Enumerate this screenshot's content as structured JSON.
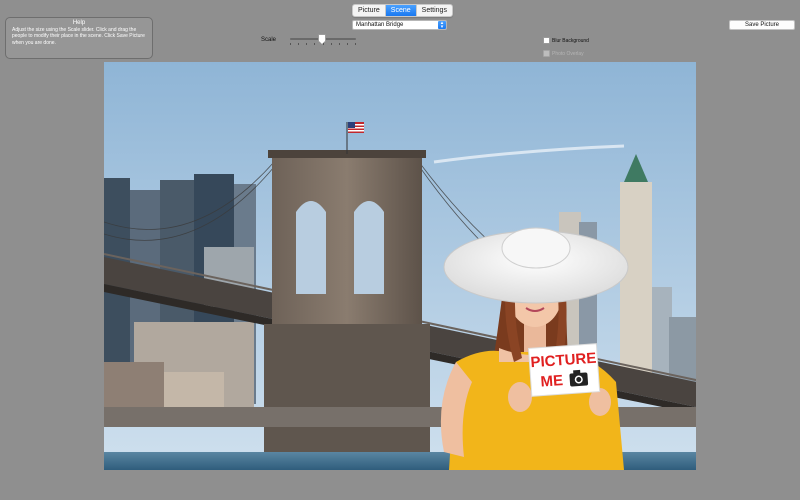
{
  "tabs": [
    {
      "label": "Picture",
      "active": false
    },
    {
      "label": "Scene",
      "active": true
    },
    {
      "label": "Settings",
      "active": false
    }
  ],
  "help": {
    "title": "Help",
    "text": "Adjust the size using the Scale slider. Click and drag the people to modify their place in the scene. Click Save Picture when you are done."
  },
  "scene_select": {
    "value": "Manhattan Bridge"
  },
  "save_button": {
    "label": "Save Picture"
  },
  "scale": {
    "label": "Scale",
    "value": 0.48
  },
  "options": {
    "blur_background": {
      "label": "Blur Background",
      "checked": false,
      "enabled": true
    },
    "photo_overlay": {
      "label": "Photo Overlay",
      "checked": false,
      "enabled": false
    }
  },
  "scene": {
    "sign_line1": "PICTURE",
    "sign_line2": "ME"
  },
  "colors": {
    "accent": "#1a78f0",
    "window_bg": "#8f8f8f",
    "sky": "#a9c8e2",
    "water": "#46728e",
    "dress": "#f2b51a",
    "sign_text": "#e02020"
  }
}
